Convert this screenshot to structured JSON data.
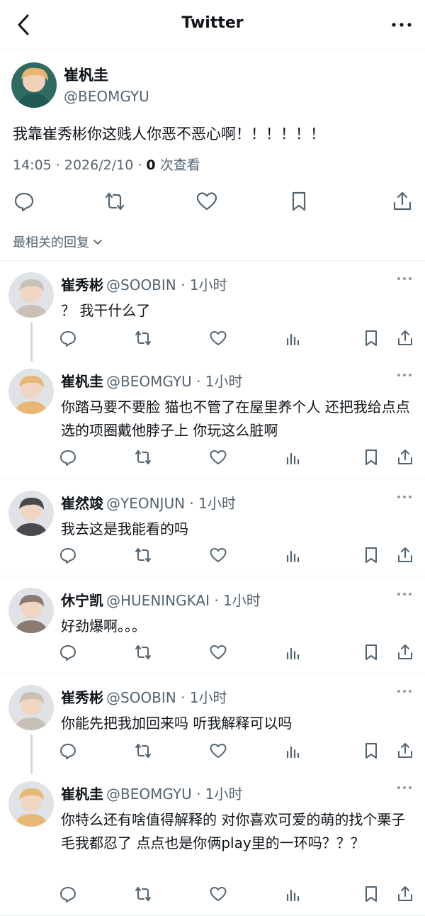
{
  "nav": {
    "title": "Twitter",
    "back_icon": "chevron-left-icon",
    "more_icon": "more-horizontal-icon"
  },
  "main_tweet": {
    "author": "崔杋圭",
    "handle": "@BEOMGYU",
    "text": "我靠崔秀彬你这贱人你恶不恶心啊！！！！！！",
    "time": "14:05 · 2026/2/10 · ",
    "views_count": "0",
    "views_label": " 次查看",
    "sort_label": "最相关的回复"
  },
  "replies": [
    {
      "author": "崔秀彬",
      "handle": "@SOOBIN",
      "time": " · 1小时",
      "text": "？ 我干什么了",
      "avatar_color": "#c9c0b6"
    },
    {
      "author": "崔杋圭",
      "handle": "@BEOMGYU",
      "time": " · 1小时",
      "text": "你踏马要不要脸 猫也不管了在屋里养个人 还把我给点点选的项圈戴他脖子上 你玩这么脏啊",
      "avatar_color": "#e6b874"
    },
    {
      "author": "崔然竣",
      "handle": "@YEONJUN",
      "time": " · 1小时",
      "text": "我去这是我能看的吗",
      "avatar_color": "#4a4a4e"
    },
    {
      "author": "休宁凯",
      "handle": "@HUENINGKAI",
      "time": " · 1小时",
      "text": "好劲爆啊。。。",
      "avatar_color": "#8a7a70"
    },
    {
      "author": "崔秀彬",
      "handle": "@SOOBIN",
      "time": " · 1小时",
      "text": "你能先把我加回来吗 听我解释可以吗",
      "avatar_color": "#c9c0b6"
    },
    {
      "author": "崔杋圭",
      "handle": "@BEOMGYU",
      "time": " · 1小时",
      "text": "你特么还有啥值得解释的 对你喜欢可爱的萌的找个栗子毛我都忍了 点点也是你俩play里的一环吗？？？",
      "avatar_color": "#e6b874"
    }
  ],
  "colors": {
    "text": "#0f1419",
    "secondary": "#536471",
    "divider": "#eff3f4",
    "thread": "#cfd9de"
  }
}
